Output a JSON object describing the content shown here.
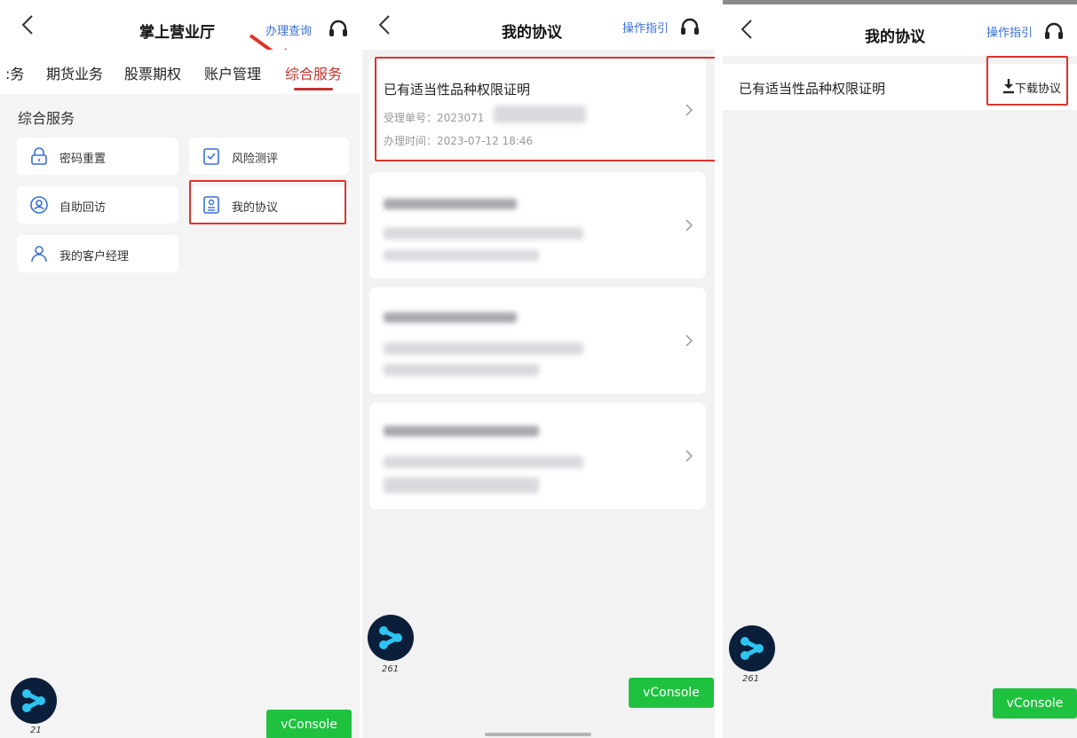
{
  "panel1": {
    "title": "掌上营业厅",
    "header_link": "办理查询",
    "tabs": [
      ":务",
      "期货业务",
      "股票期权",
      "账户管理",
      "综合服务"
    ],
    "section_title": "综合服务",
    "services": [
      {
        "label": "密码重置",
        "icon": "lock-icon"
      },
      {
        "label": "风险测评",
        "icon": "clipboard-check-icon"
      },
      {
        "label": "自助回访",
        "icon": "person-circle-icon"
      },
      {
        "label": "我的协议",
        "icon": "agreement-icon"
      },
      {
        "label": "我的客户经理",
        "icon": "manager-icon"
      }
    ],
    "fab_number": "21",
    "vconsole_label": "vConsole"
  },
  "panel2": {
    "title": "我的协议",
    "header_link": "操作指引",
    "card1": {
      "title": "已有适当性品种权限证明",
      "order_label": "受理单号：2023071",
      "time_label": "办理时间：2023-07-12 18:46"
    },
    "fab_number": "261",
    "vconsole_label": "vConsole"
  },
  "panel3": {
    "title": "我的协议",
    "header_link": "操作指引",
    "row_title": "已有适当性品种权限证明",
    "download_label": "下载协议",
    "fab_number": "261",
    "vconsole_label": "vConsole"
  },
  "colors": {
    "accent_red": "#c3332c",
    "highlight_red": "#e0322a",
    "link_blue": "#3a6fd8",
    "vconsole_green": "#1ec23e"
  }
}
